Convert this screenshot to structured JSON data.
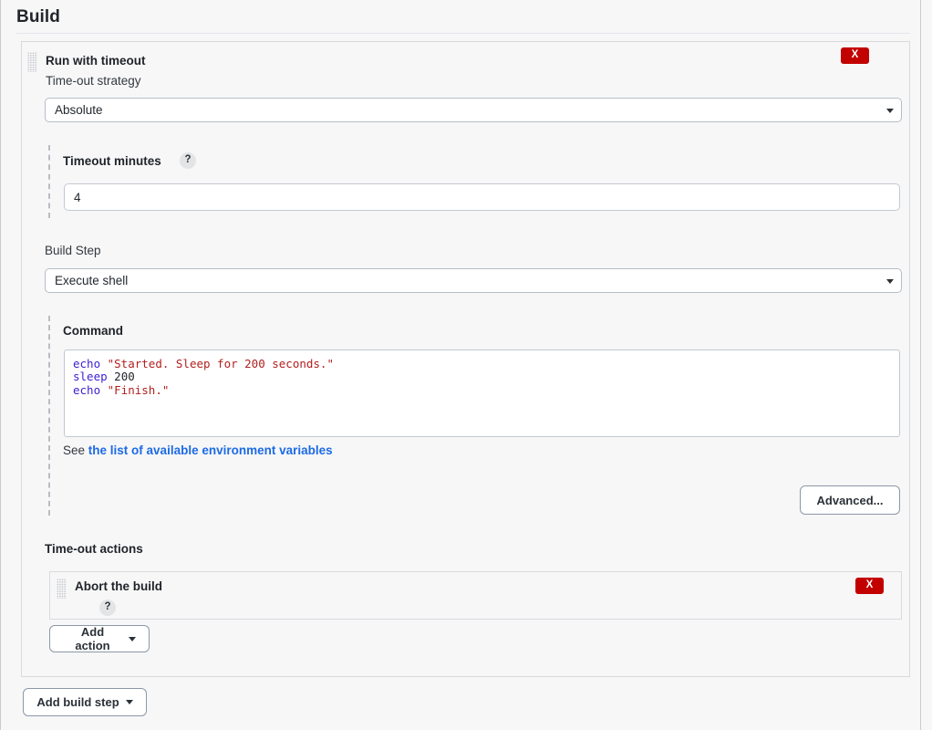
{
  "page": {
    "section_title": "Build"
  },
  "build_step": {
    "title": "Run with timeout",
    "delete_label": "X",
    "strategy_label": "Time-out strategy",
    "strategy_value": "Absolute",
    "timeout_minutes_label": "Timeout minutes",
    "timeout_minutes_help": "?",
    "timeout_minutes_value": "4",
    "build_step_label": "Build Step",
    "build_step_value": "Execute shell",
    "command_label": "Command",
    "command_code": {
      "line1_cmd": "echo",
      "line1_str": " \"Started. Sleep for 200 seconds.\"",
      "line2_cmd": "sleep",
      "line2_plain": " 200",
      "line3_cmd": "echo",
      "line3_str": " \"Finish.\""
    },
    "see_prefix": "See",
    "see_link": "the list of available environment variables",
    "advanced_label": "Advanced...",
    "timeout_actions_label": "Time-out actions",
    "action": {
      "title": "Abort the build",
      "help": "?",
      "delete_label": "X"
    },
    "add_action_label": "Add action"
  },
  "footer": {
    "add_build_step_label": "Add build step"
  },
  "colors": {
    "delete_red": "#c30000",
    "link_blue": "#1d6ae5",
    "code_keyword": "#3a1fd4",
    "code_string": "#b02020",
    "panel_bg": "#f7f7f8",
    "button_border": "#8b98a6"
  }
}
